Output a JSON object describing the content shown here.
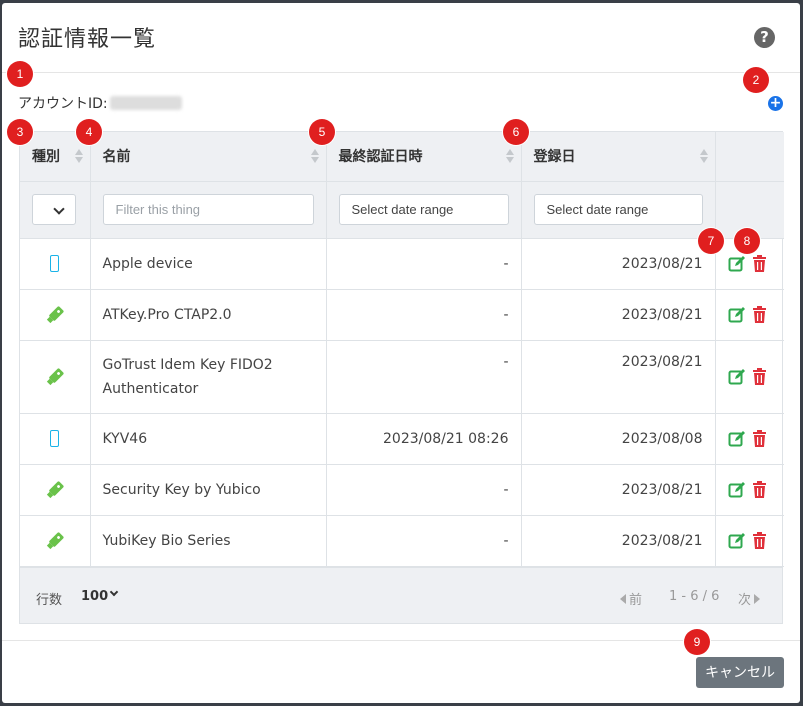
{
  "dialog": {
    "title": "認証情報一覧",
    "help_icon": "question-circle-icon",
    "add_icon": "plus-circle-icon"
  },
  "account": {
    "label": "アカウントID:"
  },
  "badges": [
    "1",
    "2",
    "3",
    "4",
    "5",
    "6",
    "7",
    "8",
    "9"
  ],
  "table": {
    "columns": [
      {
        "label": "種別"
      },
      {
        "label": "名前"
      },
      {
        "label": "最終認証日時"
      },
      {
        "label": "登録日"
      },
      {
        "label": ""
      }
    ],
    "filters": {
      "name_placeholder": "Filter this thing",
      "last_auth_placeholder": "Select date range",
      "registered_placeholder": "Select date range"
    },
    "rows": [
      {
        "type_icon": "smartphone-icon",
        "name": "Apple device",
        "last_auth": "-",
        "registered": "2023/08/21"
      },
      {
        "type_icon": "usb-key-icon",
        "name": "ATKey.Pro CTAP2.0",
        "last_auth": "-",
        "registered": "2023/08/21"
      },
      {
        "type_icon": "usb-key-icon",
        "name": "GoTrust Idem Key FIDO2 Authenticator",
        "last_auth": "-",
        "registered": "2023/08/21"
      },
      {
        "type_icon": "smartphone-icon",
        "name": "KYV46",
        "last_auth": "2023/08/21 08:26",
        "registered": "2023/08/08"
      },
      {
        "type_icon": "usb-key-icon",
        "name": "Security Key by Yubico",
        "last_auth": "-",
        "registered": "2023/08/21"
      },
      {
        "type_icon": "usb-key-icon",
        "name": "YubiKey Bio Series",
        "last_auth": "-",
        "registered": "2023/08/21"
      }
    ],
    "row_actions": {
      "edit_icon": "edit-icon",
      "delete_icon": "trash-icon"
    }
  },
  "footer": {
    "rows_label": "行数",
    "rows_value": "100",
    "prev": "前",
    "page_info": "1 - 6 / 6",
    "next": "次"
  },
  "cancel_label": "キャンセル",
  "colors": {
    "badge": "#e01f1f",
    "phone": "#1ab3e8",
    "key": "#6ac24a",
    "edit": "#2fa84f",
    "delete": "#e0303a",
    "cancel": "#6c757d"
  }
}
